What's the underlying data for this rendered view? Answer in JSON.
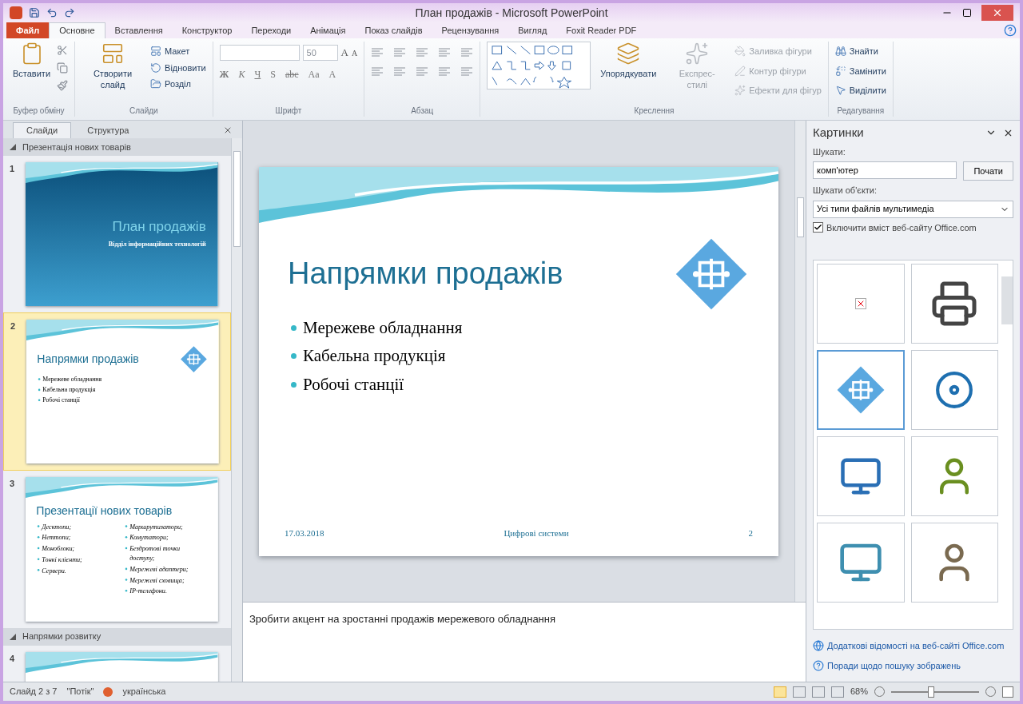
{
  "window": {
    "title": "План продажів - Microsoft PowerPoint"
  },
  "tabs": [
    {
      "label": "Файл",
      "kind": "file",
      "selected": false
    },
    {
      "label": "Основне",
      "kind": "tab",
      "selected": true
    },
    {
      "label": "Вставлення",
      "kind": "tab",
      "selected": false
    },
    {
      "label": "Конструктор",
      "kind": "tab",
      "selected": false
    },
    {
      "label": "Переходи",
      "kind": "tab",
      "selected": false
    },
    {
      "label": "Анімація",
      "kind": "tab",
      "selected": false
    },
    {
      "label": "Показ слайдів",
      "kind": "tab",
      "selected": false
    },
    {
      "label": "Рецензування",
      "kind": "tab",
      "selected": false
    },
    {
      "label": "Вигляд",
      "kind": "tab",
      "selected": false
    },
    {
      "label": "Foxit Reader PDF",
      "kind": "tab",
      "selected": false
    }
  ],
  "ribbon": [
    {
      "label": "Буфер обміну",
      "kind": "clipboard",
      "items": [
        {
          "label": "Вставити",
          "disabled": false
        }
      ]
    },
    {
      "label": "Слайди",
      "kind": "slides",
      "items": [
        {
          "label": "Створити слайд",
          "disabled": false
        },
        {
          "label": "Макет",
          "disabled": false
        },
        {
          "label": "Відновити",
          "disabled": false
        },
        {
          "label": "Розділ",
          "disabled": false
        }
      ]
    },
    {
      "label": "Шрифт",
      "kind": "font",
      "font_size": "50",
      "size_buttons": [
        "A",
        "A"
      ],
      "format_buttons": [
        "Ж",
        "К",
        "Ч",
        "S",
        "abc",
        "Aa",
        "A"
      ]
    },
    {
      "label": "Абзац",
      "kind": "paragraph"
    },
    {
      "label": "Креслення",
      "kind": "drawing",
      "items": [
        {
          "label": "Упорядкувати",
          "disabled": false
        },
        {
          "label": "Експрес-стилі",
          "disabled": true
        },
        {
          "label": "Заливка фігури",
          "disabled": true
        },
        {
          "label": "Контур фігури",
          "disabled": true
        },
        {
          "label": "Ефекти для фігур",
          "disabled": true
        }
      ]
    },
    {
      "label": "Редагування",
      "kind": "editing",
      "items": [
        {
          "label": "Знайти",
          "disabled": false
        },
        {
          "label": "Замінити",
          "disabled": false
        },
        {
          "label": "Виділити",
          "disabled": false
        }
      ]
    }
  ],
  "slides_pane": {
    "tabs": [
      {
        "label": "Слайди",
        "selected": true
      },
      {
        "label": "Структура",
        "selected": false
      }
    ],
    "sections": [
      {
        "title": "Презентація нових товарів",
        "expanded": true,
        "slides": [
          {
            "number": "1",
            "selected": false,
            "kind": "title",
            "title": "План продажів",
            "subtitle": "Відділ інформаційних технологій"
          },
          {
            "number": "2",
            "selected": true,
            "kind": "bullets",
            "title": "Напрямки продажів",
            "bullets": [
              "Мережеве обладнання",
              "Кабельна продукція",
              "Робочі станції"
            ]
          },
          {
            "number": "3",
            "selected": false,
            "kind": "two_column",
            "title": "Презентації нових товарів",
            "left": [
              "Десктопи;",
              "Неттопи;",
              "Моноблоки;",
              "Тонкі клієнти;",
              "Сервери."
            ],
            "right": [
              "Маршрутизатори;",
              "Комутатори;",
              "Бездротові точки доступу;",
              "Мережеві адаптери;",
              "Мережеві сховища;",
              "IP-телефони."
            ]
          }
        ]
      },
      {
        "title": "Напрямки розвитку",
        "expanded": true,
        "slides": [
          {
            "number": "4",
            "selected": false,
            "kind": "blank"
          }
        ]
      }
    ]
  },
  "slide": {
    "title": "Напрямки продажів",
    "bullets": [
      "Мережеве обладнання",
      "Кабельна продукція",
      "Робочі станції"
    ],
    "date": "17.03.2018",
    "footer": "Цифрові системи",
    "number": "2"
  },
  "notes": "Зробити акцент на зростанні продажів мережевого обладнання",
  "clip_art": {
    "title": "Картинки",
    "search_label": "Шукати:",
    "search_value": "комп'ютер",
    "go_button": "Почати",
    "type_label": "Шукати об'єкти:",
    "type_value": "Усі типи файлів мультимедіа",
    "include_office": {
      "label": "Включити вміст веб-сайту Office.com",
      "checked": true
    },
    "results": [
      {
        "kind": "broken",
        "selected": false
      },
      {
        "kind": "scanner",
        "selected": false
      },
      {
        "kind": "circuit",
        "selected": true
      },
      {
        "kind": "disk",
        "selected": false
      },
      {
        "kind": "computer",
        "selected": false
      },
      {
        "kind": "desk",
        "selected": false
      },
      {
        "kind": "monitor",
        "selected": false
      },
      {
        "kind": "person",
        "selected": false
      }
    ],
    "links": [
      "Додаткові відомості на веб-сайті Office.com",
      "Поради щодо пошуку зображень"
    ]
  },
  "status_bar": {
    "slide": "Слайд 2 з 7",
    "theme": "\"Потік\"",
    "language": "українська",
    "views": [
      {
        "selected": true
      },
      {
        "selected": false
      },
      {
        "selected": false
      },
      {
        "selected": false
      }
    ],
    "zoom": "68%",
    "zoom_level": {
      "level": 0.45
    }
  }
}
